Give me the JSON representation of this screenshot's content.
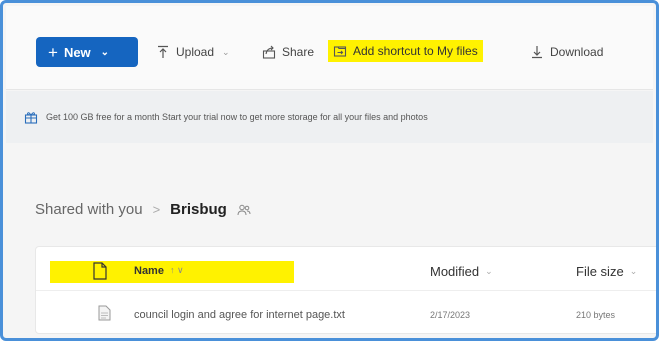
{
  "toolbar": {
    "new_label": "New",
    "upload_label": "Upload",
    "share_label": "Share",
    "add_shortcut_label": "Add shortcut to My files",
    "download_label": "Download"
  },
  "banner": {
    "text": "Get 100 GB free for a month   Start your trial now to get more storage for all your files and photos"
  },
  "breadcrumb": {
    "root": "Shared with you",
    "separator": ">",
    "current": "Brisbug"
  },
  "list": {
    "columns": {
      "name": "Name",
      "name_sort": "↑ ∨",
      "modified": "Modified",
      "file_size": "File size"
    },
    "rows": [
      {
        "name": "council login and agree for internet page.txt",
        "modified": "2/17/2023",
        "size": "210 bytes"
      }
    ]
  },
  "colors": {
    "accent": "#1565c0",
    "highlight": "#fff200",
    "frame_border": "#4a90d9"
  },
  "icons": [
    "plus-icon",
    "upload-icon",
    "share-icon",
    "add-shortcut-icon",
    "download-icon",
    "gift-icon",
    "people-icon",
    "file-icon"
  ]
}
